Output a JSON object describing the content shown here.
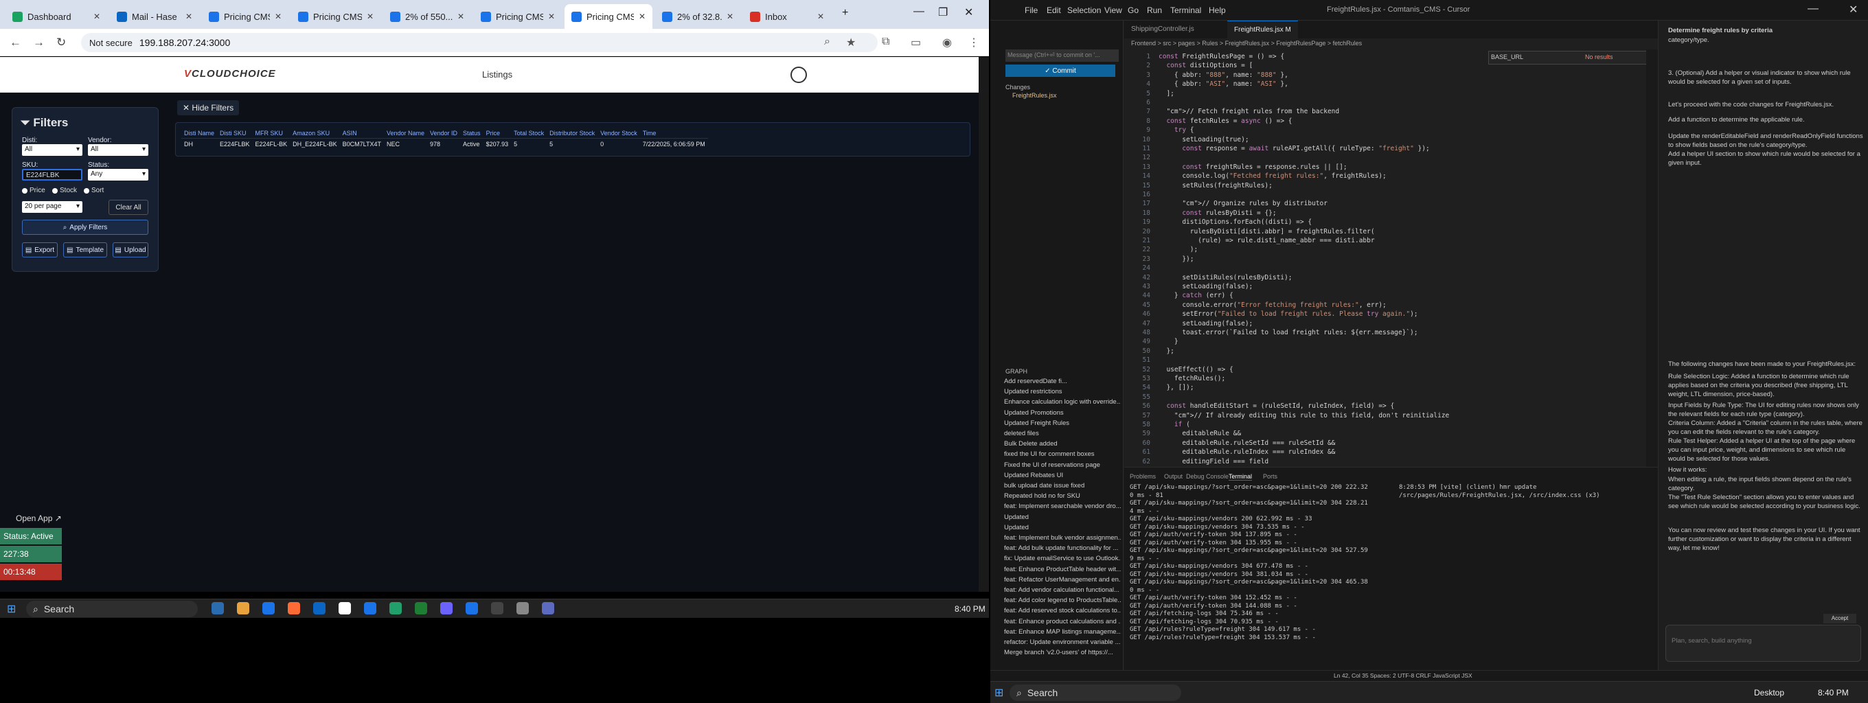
{
  "browser": {
    "tabs": [
      {
        "label": "Dashboard",
        "color": "#1aa260",
        "active": false
      },
      {
        "label": "Mail - Hase",
        "color": "#0a66c2",
        "active": false
      },
      {
        "label": "Pricing CMS",
        "color": "#1a73e8",
        "active": false
      },
      {
        "label": "Pricing CMS",
        "color": "#1a73e8",
        "active": false
      },
      {
        "label": "2% of 550...",
        "color": "#1a73e8",
        "active": false
      },
      {
        "label": "Pricing CMS",
        "color": "#1a73e8",
        "active": false
      },
      {
        "label": "Pricing CMS",
        "color": "#1a73e8",
        "active": true
      },
      {
        "label": "2% of 32.8...",
        "color": "#1a73e8",
        "active": false
      },
      {
        "label": "Inbox",
        "color": "#d93025",
        "active": false
      }
    ],
    "security": "Not secure",
    "url": "199.188.207.24:3000"
  },
  "app": {
    "logo_v": "V",
    "logo_text": "CLOUDCHOICE",
    "nav_listings": "Listings",
    "filters_title": "Filters",
    "disti_label": "Disti:",
    "disti_value": "All",
    "vendor_label": "Vendor:",
    "vendor_value": "All",
    "sku_label": "SKU:",
    "sku_value": "E224FLBK",
    "status_label": "Status:",
    "status_value": "Any",
    "radio_price": "Price",
    "radio_stock": "Stock",
    "radio_sort": "Sort",
    "per_page": "20 per page",
    "clear_all": "Clear All",
    "apply": "Apply Filters",
    "export": "Export",
    "template": "Template",
    "upload": "Upload",
    "hide_filters": "Hide Filters",
    "columns": [
      "Disti Name",
      "Disti SKU",
      "MFR SKU",
      "Amazon SKU",
      "ASIN",
      "Vendor Name",
      "Vendor ID",
      "Status",
      "Price",
      "Total Stock",
      "Distributor Stock",
      "Vendor Stock",
      "Time"
    ],
    "rows": [
      [
        "DH",
        "E224FLBK",
        "E224FL-BK",
        "DH_E224FL-BK",
        "B0CM7LTX4T",
        "NEC",
        "978",
        "Active",
        "$207.93",
        "5",
        "5",
        "0",
        "7/22/2025, 6:06:59 PM"
      ]
    ],
    "open_app": "Open App ↗",
    "status_active": "Status: Active",
    "timer1": "227:38",
    "timer2": "00:13:48"
  },
  "left_taskbar": {
    "search": "Search",
    "time": "8:40 PM"
  },
  "ide": {
    "menus": [
      "File",
      "Edit",
      "Selection",
      "View",
      "Go",
      "Run",
      "Terminal",
      "Help"
    ],
    "title": "FreightRules.jsx - Comtanis_CMS - Cursor",
    "tabs": [
      "ShippingController.js",
      "FreightRules.jsx M"
    ],
    "breadcrumb": "Frontend > src > pages > Rules > FreightRules.jsx > FreightRulesPage > fetchRules",
    "commit_placeholder": "Message (Ctrl+⏎ to commit on '...",
    "commit_label": "✓ Commit",
    "changes_label": "Changes",
    "changed_file": "FreightRules.jsx",
    "graph_label": "GRAPH",
    "graph_items": [
      "Add reservedDate fi...",
      "Updated restrictions",
      "Enhance calculation logic with override...",
      "Updated Promotions",
      "Updated Freight Rules",
      "deleted files",
      "Bulk Delete added",
      "fixed the UI for comment boxes",
      "Fixed the UI of reservations page",
      "Updated Rebates UI",
      "bulk upload date issue fixed",
      "Repeated hold no for SKU",
      "feat: Implement searchable vendor dro...",
      "Updated",
      "Updated",
      "feat: Implement bulk vendor assignmen...",
      "feat: Add bulk update functionality for ...",
      "fix: Update emailService to use Outlook...",
      "feat: Enhance ProductTable header wit...",
      "feat: Refactor UserManagement and en...",
      "feat: Add vendor calculation functional...",
      "feat: Add color legend to ProductsTable...",
      "feat: Add reserved stock calculations to...",
      "feat: Enhance product calculations and ...",
      "feat: Enhance MAP listings manageme...",
      "refactor: Update environment variable ...",
      "Merge branch 'v2.0-users' of https://..."
    ],
    "find_value": "BASE_URL",
    "find_result": "No results",
    "code": [
      {
        "n": "1",
        "t": "const FreightRulesPage = () => {"
      },
      {
        "n": "2",
        "t": "  const distiOptions = ["
      },
      {
        "n": "3",
        "t": "    { abbr: \"888\", name: \"888\" },"
      },
      {
        "n": "4",
        "t": "    { abbr: \"ASI\", name: \"ASI\" },"
      },
      {
        "n": "5",
        "t": "  ];"
      },
      {
        "n": "6",
        "t": ""
      },
      {
        "n": "7",
        "t": "  // Fetch freight rules from the backend"
      },
      {
        "n": "8",
        "t": "  const fetchRules = async () => {"
      },
      {
        "n": "9",
        "t": "    try {"
      },
      {
        "n": "10",
        "t": "      setLoading(true);"
      },
      {
        "n": "11",
        "t": "      const response = await ruleAPI.getAll({ ruleType: \"freight\" });"
      },
      {
        "n": "12",
        "t": ""
      },
      {
        "n": "13",
        "t": "      const freightRules = response.rules || [];"
      },
      {
        "n": "14",
        "t": "      console.log(\"Fetched freight rules:\", freightRules);"
      },
      {
        "n": "15",
        "t": "      setRules(freightRules);"
      },
      {
        "n": "16",
        "t": ""
      },
      {
        "n": "17",
        "t": "      // Organize rules by distributor"
      },
      {
        "n": "18",
        "t": "      const rulesByDisti = {};"
      },
      {
        "n": "19",
        "t": "      distiOptions.forEach((disti) => {"
      },
      {
        "n": "20",
        "t": "        rulesByDisti[disti.abbr] = freightRules.filter("
      },
      {
        "n": "21",
        "t": "          (rule) => rule.disti_name_abbr === disti.abbr"
      },
      {
        "n": "22",
        "t": "        );"
      },
      {
        "n": "23",
        "t": "      });"
      },
      {
        "n": "24",
        "t": ""
      },
      {
        "n": "42",
        "t": "      setDistiRules(rulesByDisti);"
      },
      {
        "n": "43",
        "t": "      setLoading(false);"
      },
      {
        "n": "44",
        "t": "    } catch (err) {"
      },
      {
        "n": "45",
        "t": "      console.error(\"Error fetching freight rules:\", err);"
      },
      {
        "n": "46",
        "t": "      setError(\"Failed to load freight rules. Please try again.\");"
      },
      {
        "n": "47",
        "t": "      setLoading(false);"
      },
      {
        "n": "48",
        "t": "      toast.error(`Failed to load freight rules: ${err.message}`);"
      },
      {
        "n": "49",
        "t": "    }"
      },
      {
        "n": "50",
        "t": "  };"
      },
      {
        "n": "51",
        "t": ""
      },
      {
        "n": "52",
        "t": "  useEffect(() => {"
      },
      {
        "n": "53",
        "t": "    fetchRules();"
      },
      {
        "n": "54",
        "t": "  }, []);"
      },
      {
        "n": "55",
        "t": ""
      },
      {
        "n": "56",
        "t": "  const handleEditStart = (ruleSetId, ruleIndex, field) => {"
      },
      {
        "n": "57",
        "t": "    // If already editing this rule to this field, don't reinitialize"
      },
      {
        "n": "58",
        "t": "    if ("
      },
      {
        "n": "59",
        "t": "      editableRule &&"
      },
      {
        "n": "60",
        "t": "      editableRule.ruleSetId === ruleSetId &&"
      },
      {
        "n": "61",
        "t": "      editableRule.ruleIndex === ruleIndex &&"
      },
      {
        "n": "62",
        "t": "      editingField === field"
      },
      {
        "n": "63",
        "t": "    ) {"
      }
    ],
    "panel_tabs": [
      "Problems",
      "Output",
      "Debug Console",
      "Terminal",
      "Ports"
    ],
    "terminal_left": [
      "GET /api/sku-mappings/?sort_order=asc&page=1&limit=20 200 222.32",
      "0 ms - 81",
      "GET /api/sku-mappings/?sort_order=asc&page=1&limit=20 304 228.21",
      "4 ms - -",
      "GET /api/sku-mappings/vendors 200 622.992 ms - 33",
      "GET /api/sku-mappings/vendors 304 73.535 ms - -",
      "GET /api/auth/verify-token 304 137.895 ms - -",
      "GET /api/auth/verify-token 304 135.955 ms - -",
      "GET /api/sku-mappings/?sort_order=asc&page=1&limit=20 304 527.59",
      "9 ms - -",
      "GET /api/sku-mappings/vendors 304 677.478 ms - -",
      "GET /api/sku-mappings/vendors 304 381.034 ms - -",
      "GET /api/sku-mappings/?sort_order=asc&page=1&limit=20 304 465.38",
      "0 ms - -",
      "GET /api/auth/verify-token 304 152.452 ms - -",
      "GET /api/auth/verify-token 304 144.088 ms - -",
      "GET /api/fetching-logs 304 75.346 ms - -",
      "GET /api/fetching-logs 304 70.935 ms - -",
      "GET /api/rules?ruleType=freight 304 149.617 ms - -",
      "GET /api/rules?ruleType=freight 304 153.537 ms - -"
    ],
    "terminal_right": "8:28:53 PM [vite] (client) hmr update /src/pages/Rules/FreightRules.jsx, /src/index.css (x3)",
    "chat": [
      "Determine freight rules by criteria",
      "category/type.",
      "3. (Optional) Add a helper or visual indicator to show which rule would be selected for a given set of inputs.",
      "Let's proceed with the code changes for FreightRules.jsx.",
      "Add a function to determine the applicable rule.",
      "Update the renderEditableField and renderReadOnlyField functions to show fields based on the rule's category/type.",
      "Add a helper UI section to show which rule would be selected for a given input.",
      "The following changes have been made to your FreightRules.jsx:",
      "Rule Selection Logic: Added a function to determine which rule applies based on the criteria you described (free shipping, LTL weight, LTL dimension, price-based).",
      "Input Fields by Rule Type: The UI for editing rules now shows only the relevant fields for each rule type (category).",
      "Criteria Column: Added a \"Criteria\" column in the rules table, where you can edit the fields relevant to the rule's category.",
      "Rule Test Helper: Added a helper UI at the top of the page where you can input price, weight, and dimensions to see which rule would be selected for those values.",
      "How it works:",
      "When editing a rule, the input fields shown depend on the rule's category.",
      "The \"Test Rule Selection\" section allows you to enter values and see which rule would be selected according to your business logic.",
      "You can now review and test these changes in your UI. If you want further customization or want to display the criteria in a different way, let me know!"
    ],
    "chat_input_placeholder": "Plan, search, build anything",
    "accept_label": "Accept",
    "status_items": "Ln 42, Col 35   Spaces: 2   UTF-8   CRLF   JavaScript JSX",
    "taskbar_search": "Search",
    "desktop_label": "Desktop",
    "time": "8:40 PM"
  }
}
